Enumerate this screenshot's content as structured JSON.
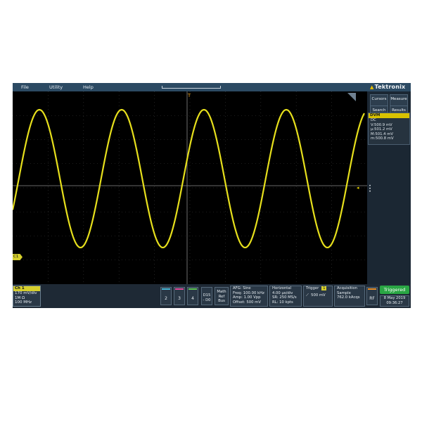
{
  "menubar": {
    "items": [
      "File",
      "Utility",
      "Help"
    ],
    "brand": "Tektronix"
  },
  "side": {
    "cursors": "Cursors",
    "measure": "Measure",
    "search": "Search",
    "results_table": "Results Table",
    "dvm": {
      "title": "DVM",
      "lines": [
        "DC",
        "V:500.9 mV",
        "μ:501.2 mV",
        "M:501.4 mV",
        "m:500.8 mV"
      ]
    }
  },
  "waveform": {
    "label": "C1",
    "color": "#e6df1c",
    "cycles_visible": 4,
    "shape": "sine"
  },
  "bottom": {
    "ch1": {
      "title": "Ch 1",
      "lines": [
        "170 mV/div",
        "1M Ω",
        "100 MHz"
      ]
    },
    "channels": [
      {
        "num": "2",
        "color": "#49b6d6"
      },
      {
        "num": "3",
        "color": "#e04f9c"
      },
      {
        "num": "4",
        "color": "#5ec456"
      }
    ],
    "d15": "D15 - D0",
    "math": "Math Ref Bus",
    "afg": {
      "title": "AFG: Sine",
      "lines": [
        "Freq: 100.00 kHz",
        "Amp: 1.00 Vpp",
        "Offset: 500 mV"
      ]
    },
    "horizontal": {
      "title": "Horizontal",
      "lines": [
        "4.00 μs/div",
        "SR: 250 MS/s",
        "RL: 10 kpts"
      ]
    },
    "trigger": {
      "title": "Trigger",
      "tag": "1",
      "value": "500 mV"
    },
    "acquisition": {
      "title": "Acquisition",
      "lines": [
        "Sample",
        "762.0 kAcqs"
      ]
    },
    "rf": "RF",
    "triggered": "Triggered",
    "date": "8 May 2019",
    "time": "09:36:27"
  }
}
